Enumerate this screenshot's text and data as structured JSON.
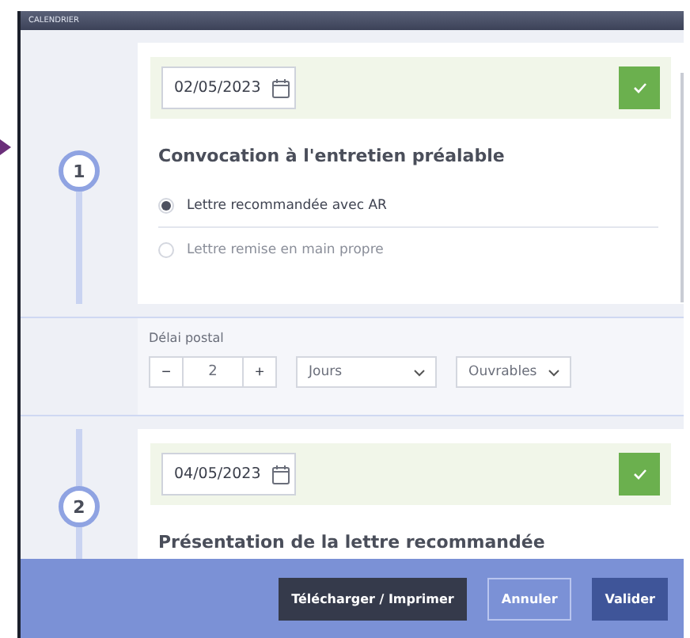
{
  "window": {
    "title": "CALENDRIER"
  },
  "steps": [
    {
      "number": "1",
      "date": "02/05/2023",
      "done": true,
      "title": "Convocation à l'entretien préalable",
      "options": [
        {
          "label": "Lettre recommandée avec AR",
          "selected": true
        },
        {
          "label": "Lettre remise en main propre",
          "selected": false
        }
      ]
    },
    {
      "number": "2",
      "date": "04/05/2023",
      "done": true,
      "title": "Présentation de la lettre recommandée"
    }
  ],
  "postal_delay": {
    "label": "Délai postal",
    "minus": "−",
    "value": "2",
    "plus": "+",
    "unit": "Jours",
    "day_type": "Ouvrables"
  },
  "buttons": [
    {
      "label": "Télécharger / Imprimer",
      "kind": "dark"
    },
    {
      "label": "Annuler",
      "kind": "outline"
    },
    {
      "label": "Valider",
      "kind": "primary"
    }
  ]
}
